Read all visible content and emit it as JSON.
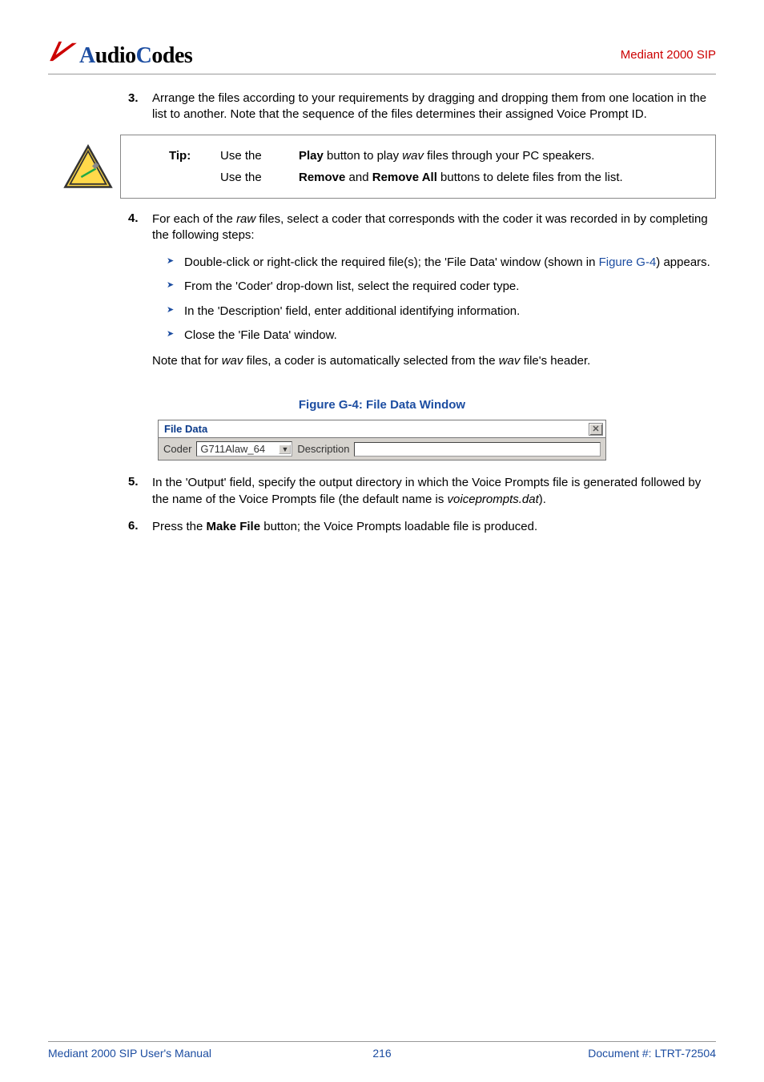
{
  "header": {
    "logo_text": "AudioCodes",
    "right": "Mediant 2000 SIP"
  },
  "step3": {
    "num": "3.",
    "text": "Arrange the files according to your requirements by dragging and dropping them from one location in the list to another. Note that the sequence of the files determines their assigned Voice Prompt ID."
  },
  "tip": {
    "label": "Tip:",
    "l1a": "Use the",
    "l1b": "Play",
    "l1c": "button to play",
    "l1d": "wav",
    "l1e": "files through your PC speakers.",
    "l2a": "Use the",
    "l2b": "Remove",
    "l2c": "and",
    "l2d": "Remove All",
    "l2e": "buttons to delete files from the list."
  },
  "step4": {
    "num": "4.",
    "text_a": "For each of the ",
    "text_b": "raw",
    "text_c": " files, select a coder that corresponds with the coder it was recorded in by completing the following steps:",
    "b1_a": "Double-click or right-click the required file(s); the 'File Data' window (shown in ",
    "b1_link": "Figure G-4",
    "b1_b": ") appears.",
    "b2": "From the 'Coder' drop-down list, select the required coder type.",
    "b3": "In the 'Description' field, enter additional identifying information.",
    "b4": "Close the 'File Data' window.",
    "note_a": "Note that for ",
    "note_b": "wav",
    "note_c": " files, a coder is automatically selected from the ",
    "note_d": "wav",
    "note_e": " file's header."
  },
  "figure": {
    "caption": "Figure G-4: File Data Window",
    "title": "File Data",
    "coder_label": "Coder",
    "coder_value": "G711Alaw_64",
    "desc_label": "Description",
    "desc_value": ""
  },
  "step5": {
    "num": "5.",
    "text_a": "In the 'Output' field, specify the output directory in which the Voice Prompts file is generated followed by the name of the Voice Prompts file (the default name is ",
    "text_b": "voiceprompts.dat",
    "text_c": ")."
  },
  "step6": {
    "num": "6.",
    "text_a": "Press the ",
    "text_b": "Make File",
    "text_c": " button; the Voice Prompts loadable file is produced."
  },
  "footer": {
    "left": "Mediant 2000 SIP User's Manual",
    "center": "216",
    "right": "Document #: LTRT-72504"
  }
}
